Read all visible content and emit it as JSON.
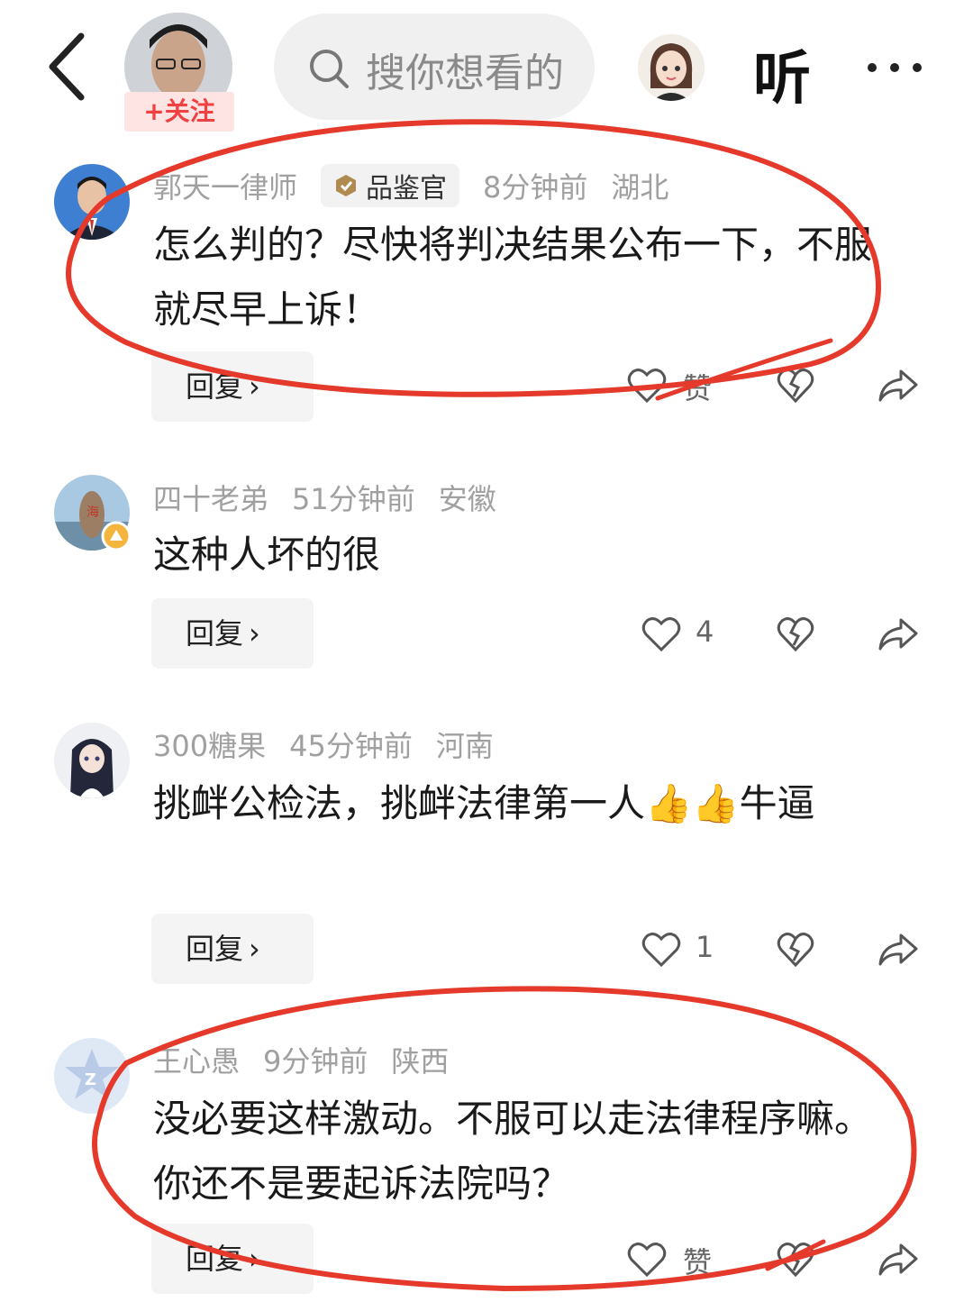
{
  "header": {
    "follow_label": "+关注",
    "search_placeholder": "搜你想看的",
    "listen_label": "听"
  },
  "comments": [
    {
      "author": "郭天一律师",
      "badge": "品鉴官",
      "time": "8分钟前",
      "location": "湖北",
      "text": "怎么判的？尽快将判决结果公布一下，不服就尽早上诉！",
      "reply_label": "回复",
      "like_count": "赞"
    },
    {
      "author": "四十老弟",
      "time": "51分钟前",
      "location": "安徽",
      "text": "这种人坏的很",
      "reply_label": "回复",
      "like_count": "4"
    },
    {
      "author": "300糖果",
      "time": "45分钟前",
      "location": "河南",
      "text": "挑衅公检法，挑衅法律第一人👍👍牛逼",
      "reply_label": "回复",
      "like_count": "1"
    },
    {
      "author": "王心愚",
      "time": "9分钟前",
      "location": "陕西",
      "text": "没必要这样激动。不服可以走法律程序嘛。你还不是要起诉法院吗？",
      "reply_label": "回复",
      "like_count": "赞"
    }
  ],
  "colors": {
    "accent_red": "#f04142",
    "annotation_red": "#e53a2b",
    "meta_gray": "#a0a0a0"
  }
}
